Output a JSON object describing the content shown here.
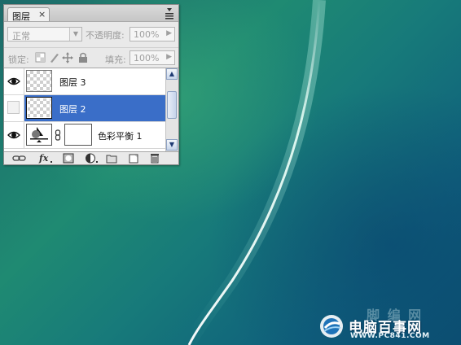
{
  "panel": {
    "tab_label": "图层",
    "tab_close": "×",
    "blend_mode": "正常",
    "opacity_label": "不透明度:",
    "opacity_value": "100%",
    "lock_label": "锁定:",
    "fill_label": "填充:",
    "fill_value": "100%"
  },
  "layers": [
    {
      "name": "图层 3",
      "visible": true,
      "selected": false
    },
    {
      "name": "图层 2",
      "visible": false,
      "selected": true
    },
    {
      "name": "色彩平衡 1",
      "visible": true,
      "selected": false,
      "type": "adjustment"
    }
  ],
  "bottom_icons": [
    "link-layers-icon",
    "fx-icon",
    "add-mask-icon",
    "adjustment-layer-icon",
    "new-group-icon",
    "new-layer-icon",
    "trash-icon"
  ],
  "watermark": {
    "faded_text": "脚 编 网",
    "title": "电脑百事网",
    "url": "WWW.PC841.COM"
  },
  "colors": {
    "selected_row": "#3a6ec8",
    "panel_bg": "#e9e9e9",
    "desktop_teal": "#1f8a72"
  }
}
